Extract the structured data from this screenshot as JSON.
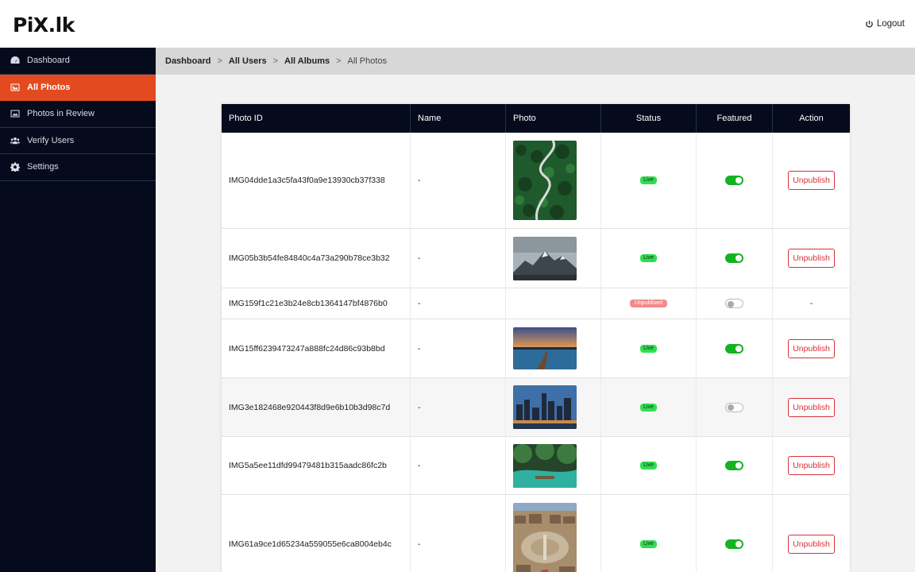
{
  "app": {
    "logo_left": "PiX",
    "logo_right": ".lk",
    "logout_label": "Logout"
  },
  "sidebar": {
    "items": [
      {
        "label": "Dashboard",
        "icon": "dashboard-icon"
      },
      {
        "label": "All Photos",
        "icon": "image-icon"
      },
      {
        "label": "Photos in Review",
        "icon": "image-icon"
      },
      {
        "label": "Verify Users",
        "icon": "users-icon"
      },
      {
        "label": "Settings",
        "icon": "gear-icon"
      }
    ]
  },
  "breadcrumb": {
    "c1": "Dashboard",
    "c2": "All Users",
    "c3": "All Albums",
    "current": "All Photos",
    "sep": ">"
  },
  "table": {
    "headers": [
      "Photo ID",
      "Name",
      "Photo",
      "Status",
      "Featured",
      "Action"
    ],
    "rows": [
      {
        "id": "IMG04dde1a3c5fa43f0a9e13930cb37f338",
        "name": "-",
        "photo": "forest-road",
        "status": "Live",
        "featured": true,
        "action": "Unpublish"
      },
      {
        "id": "IMG05b3b54fe84840c4a73a290b78ce3b32",
        "name": "-",
        "photo": "mountains",
        "status": "Live",
        "featured": true,
        "action": "Unpublish"
      },
      {
        "id": "IMG159f1c21e3b24e8cb1364147bf4876b0",
        "name": "-",
        "photo": "",
        "status": "Unpublised",
        "featured": false,
        "action": "-"
      },
      {
        "id": "IMG15ff6239473247a888fc24d86c93b8bd",
        "name": "-",
        "photo": "sunset-pier",
        "status": "Live",
        "featured": true,
        "action": "Unpublish"
      },
      {
        "id": "IMG3e182468e920443f8d9e6b10b3d98c7d",
        "name": "-",
        "photo": "city-skyline",
        "status": "Live",
        "featured": false,
        "action": "Unpublish"
      },
      {
        "id": "IMG5a5ee11dfd99479481b315aadc86fc2b",
        "name": "-",
        "photo": "green-river",
        "status": "Live",
        "featured": true,
        "action": "Unpublish"
      },
      {
        "id": "IMG61a9ce1d65234a559055e6ca8004eb4c",
        "name": "-",
        "photo": "city-aerial",
        "status": "Live",
        "featured": true,
        "action": "Unpublish"
      }
    ]
  },
  "colors": {
    "accent": "#e44a1f",
    "sidebar_bg": "#050b1c",
    "live": "#2ee04f",
    "unpublished": "#f28a8a",
    "toggle_on": "#14b320",
    "danger": "#d8323a"
  }
}
